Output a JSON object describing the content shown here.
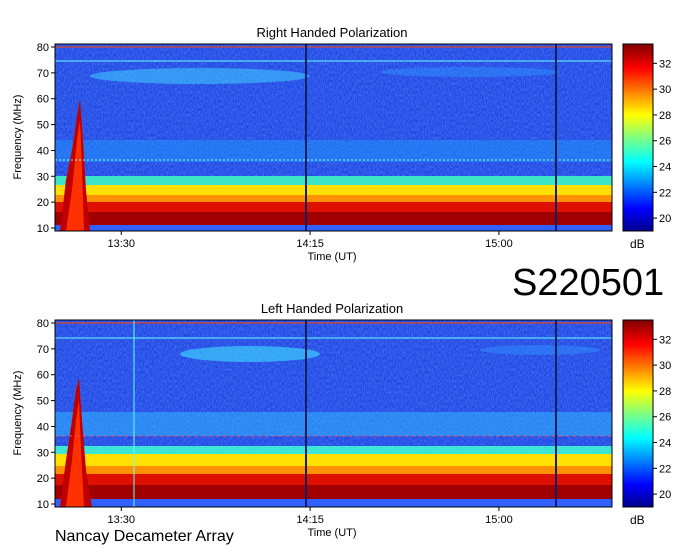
{
  "event_id": "S220501",
  "observatory": "Nancay Decameter Array",
  "chart_data": [
    {
      "type": "heatmap",
      "title": "Right Handed Polarization",
      "xlabel": "Time (UT)",
      "ylabel": "Frequency (MHz)",
      "x_ticks": [
        "13:30",
        "14:15",
        "15:00"
      ],
      "y_ticks": [
        10,
        20,
        30,
        40,
        50,
        60,
        70,
        80
      ],
      "ylim": [
        10,
        80
      ],
      "colorbar": {
        "label": "dB",
        "ticks": [
          20,
          22,
          24,
          26,
          28,
          30,
          32
        ],
        "range": [
          19,
          33.5
        ]
      },
      "colormap": [
        "#00008f",
        "#0000ff",
        "#0080ff",
        "#00ffff",
        "#80ff80",
        "#ffff00",
        "#ff8000",
        "#ff0000",
        "#800000"
      ]
    },
    {
      "type": "heatmap",
      "title": "Left Handed Polarization",
      "xlabel": "Time (UT)",
      "ylabel": "Frequency (MHz)",
      "x_ticks": [
        "13:30",
        "14:15",
        "15:00"
      ],
      "y_ticks": [
        10,
        20,
        30,
        40,
        50,
        60,
        70,
        80
      ],
      "ylim": [
        10,
        80
      ],
      "colorbar": {
        "label": "dB",
        "ticks": [
          20,
          22,
          24,
          26,
          28,
          30,
          32
        ],
        "range": [
          19,
          33.5
        ]
      },
      "colormap": [
        "#00008f",
        "#0000ff",
        "#0080ff",
        "#00ffff",
        "#80ff80",
        "#ffff00",
        "#ff8000",
        "#ff0000",
        "#800000"
      ]
    }
  ]
}
